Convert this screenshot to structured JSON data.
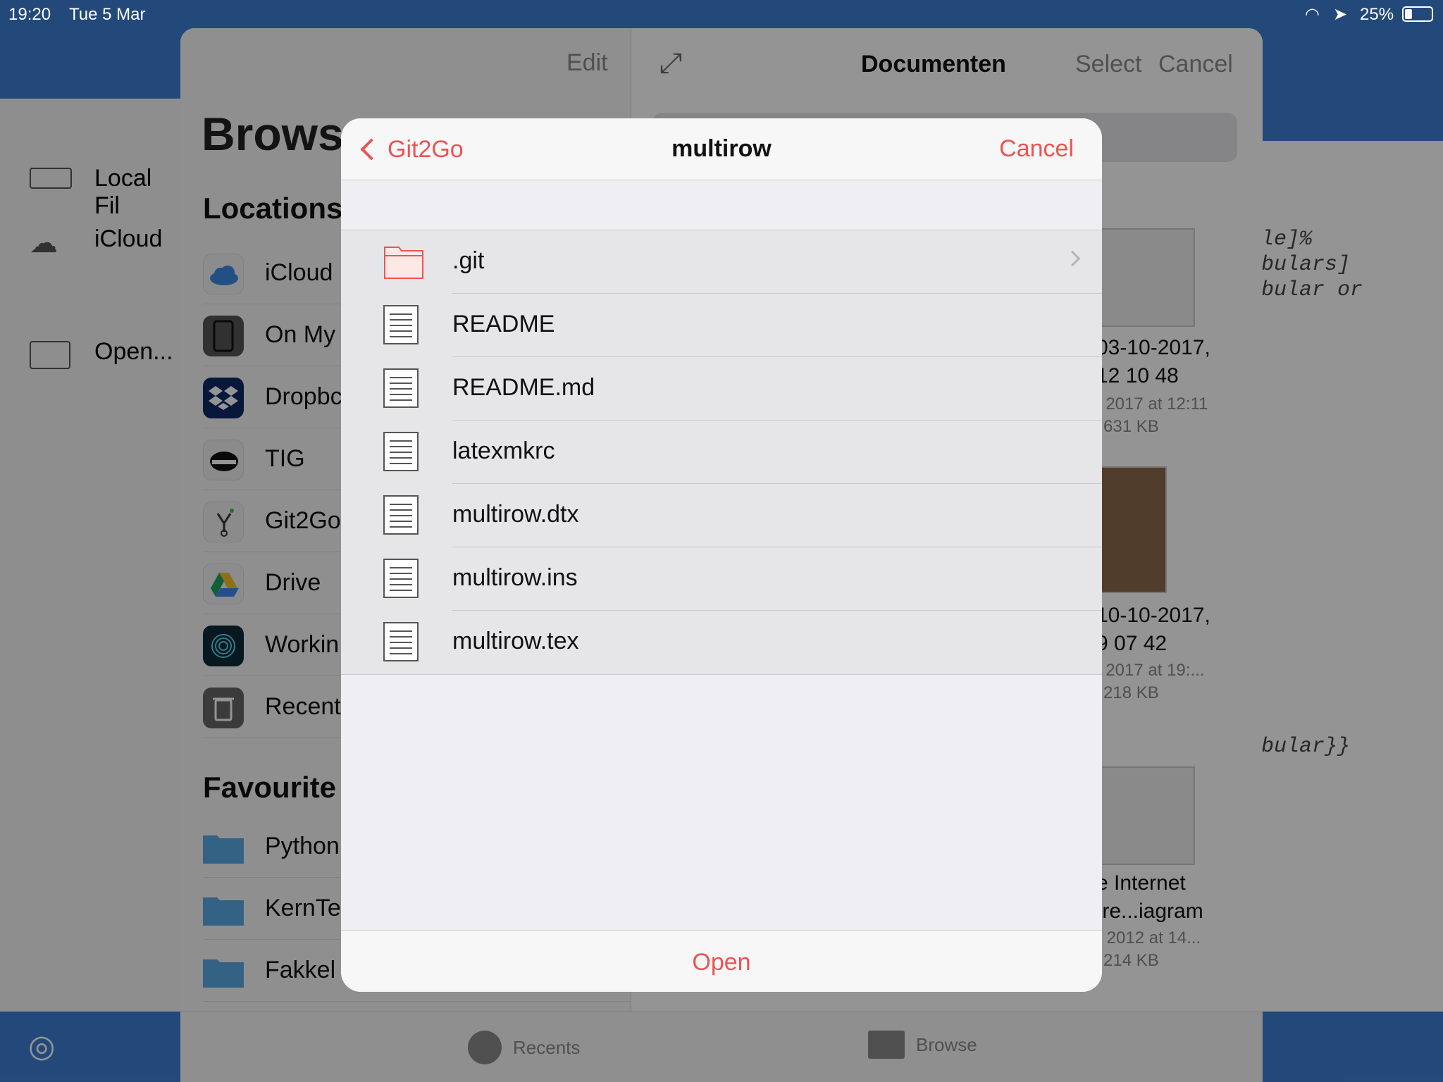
{
  "status_bar": {
    "time": "19:20",
    "date": "Tue 5 Mar",
    "battery": "25%"
  },
  "background_app": {
    "side_items": [
      "Local Fil",
      "iCloud",
      "Open..."
    ],
    "code_lines": [
      "le]%",
      "bulars]",
      "bular or",
      "bular}}"
    ]
  },
  "picker": {
    "sidebar": {
      "edit_label": "Edit",
      "title": "Brows",
      "locations_heading": "Locations",
      "locations": [
        "iCloud",
        "On My",
        "Dropbc",
        "TIG",
        "Git2Go",
        "Drive",
        "Workin",
        "Recent"
      ],
      "favourites_heading": "Favourite",
      "favourites": [
        "Python",
        "KernTe",
        "Fakkel"
      ]
    },
    "main": {
      "title": "Documenten",
      "select_label": "Select",
      "cancel_label": "Cancel",
      "files": [
        {
          "line1": "03-10-2017,",
          "line2": "12 10 48",
          "meta1": "t 2017 at 12:11",
          "meta2": "631 KB"
        },
        {
          "line1": "10-10-2017,",
          "line2": "9 07 42",
          "meta1": "t 2017 at 19:...",
          "meta2": "218 KB"
        },
        {
          "line1": "e Internet",
          "line2": "tre...iagram",
          "meta1": "r 2012 at 14...",
          "meta2": "214 KB"
        }
      ]
    },
    "tabs": {
      "recents": "Recents",
      "browse": "Browse"
    }
  },
  "modal": {
    "back_label": "Git2Go",
    "title": "multirow",
    "cancel_label": "Cancel",
    "open_label": "Open",
    "items": [
      {
        "name": ".git",
        "type": "folder"
      },
      {
        "name": "README",
        "type": "file"
      },
      {
        "name": "README.md",
        "type": "file"
      },
      {
        "name": "latexmkrc",
        "type": "file"
      },
      {
        "name": "multirow.dtx",
        "type": "file"
      },
      {
        "name": "multirow.ins",
        "type": "file"
      },
      {
        "name": "multirow.tex",
        "type": "file"
      }
    ]
  },
  "colors": {
    "accent": "#ee5350",
    "app_blue": "#3d7fd4"
  }
}
